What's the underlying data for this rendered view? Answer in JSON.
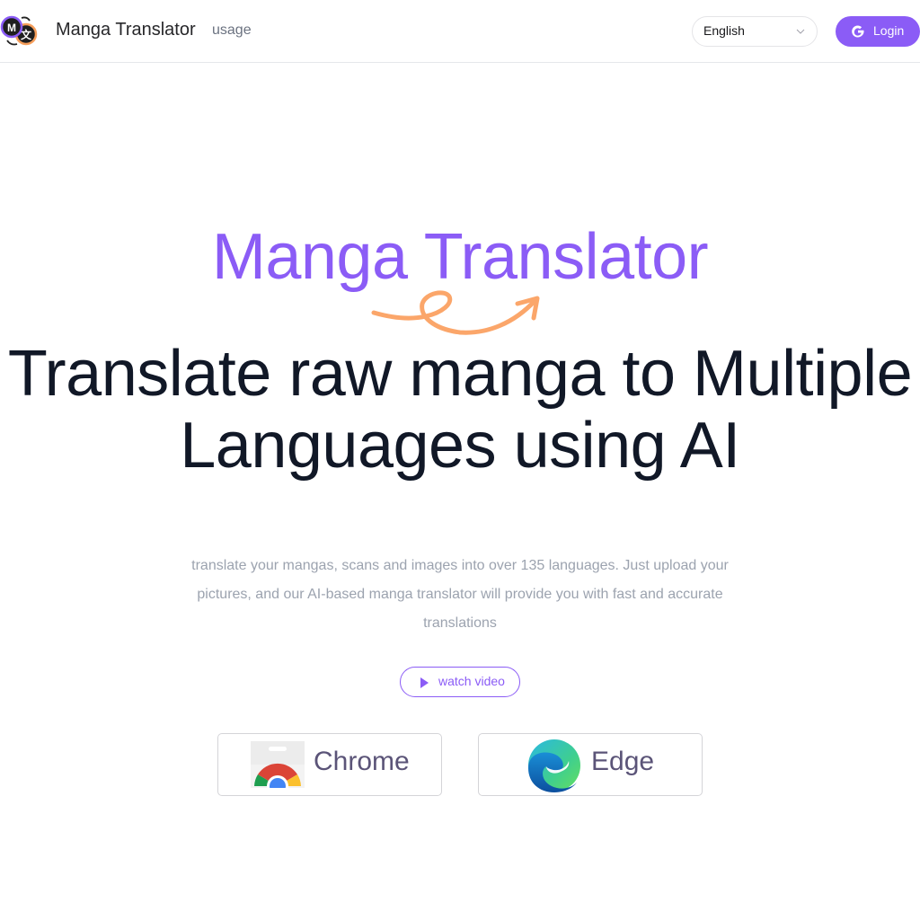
{
  "header": {
    "brand": "Manga Translator",
    "nav_usage": "usage",
    "language": {
      "selected": "English"
    },
    "login_label": "Login"
  },
  "hero": {
    "brand_title": "Manga Translator",
    "headline_line1": "Translate raw manga to Multiple",
    "headline_line2": "Languages using AI",
    "description_line1": "translate your mangas, scans and images into over 135 languages. Just upload your",
    "description_line2": "pictures, and our AI-based manga translator will provide you with fast and accurate",
    "description_line3": "translations",
    "watch_video_label": "watch video"
  },
  "extensions": [
    {
      "label": "Chrome",
      "icon": "chrome-web-store-icon"
    },
    {
      "label": "Edge",
      "icon": "edge-icon"
    }
  ],
  "colors": {
    "accent": "#8b5cf6",
    "arrow": "#fba66a",
    "heading": "#111827",
    "muted": "#9ca3af"
  }
}
